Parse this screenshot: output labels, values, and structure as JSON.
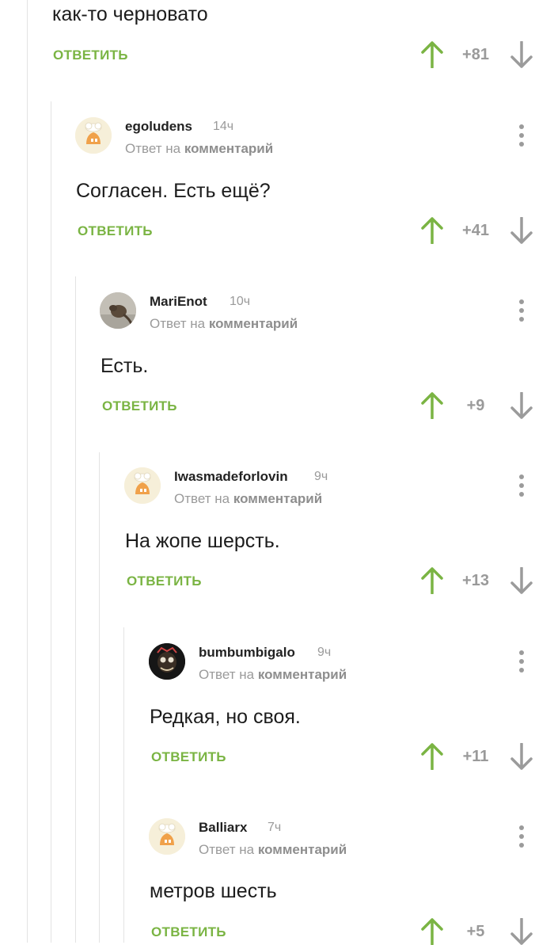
{
  "top": {
    "text": "как-то черновато",
    "reply": "ОТВЕТИТЬ",
    "score": "+81"
  },
  "comments": [
    {
      "username": "egoludens",
      "time": "14ч",
      "reply_prefix": "Ответ на",
      "reply_target": "комментарий",
      "text": "Согласен. Есть ещё?",
      "reply": "ОТВЕТИТЬ",
      "score": "+41",
      "avatar": "default-pikabu-avatar"
    },
    {
      "username": "MariEnot",
      "time": "10ч",
      "reply_prefix": "Ответ на",
      "reply_target": "комментарий",
      "text": "Есть.",
      "reply": "ОТВЕТИТЬ",
      "score": "+9",
      "avatar": "photo-avatar"
    },
    {
      "username": "Iwasmadeforlovin",
      "time": "9ч",
      "reply_prefix": "Ответ на",
      "reply_target": "комментарий",
      "text": "На жопе шерсть.",
      "reply": "ОТВЕТИТЬ",
      "score": "+13",
      "avatar": "default-pikabu-avatar"
    },
    {
      "username": "bumbumbigalo",
      "time": "9ч",
      "reply_prefix": "Ответ на",
      "reply_target": "комментарий",
      "text": "Редкая, но своя.",
      "reply": "ОТВЕТИТЬ",
      "score": "+11",
      "avatar": "dark-character-avatar"
    },
    {
      "username": "Balliarx",
      "time": "7ч",
      "reply_prefix": "Ответ на",
      "reply_target": "комментарий",
      "text": "метров шесть",
      "reply": "ОТВЕТИТЬ",
      "score": "+5",
      "avatar": "default-pikabu-avatar"
    }
  ],
  "colors": {
    "accent_green": "#7ab443",
    "muted": "#9a9a9a",
    "thread_line": "#e3e3e3"
  }
}
